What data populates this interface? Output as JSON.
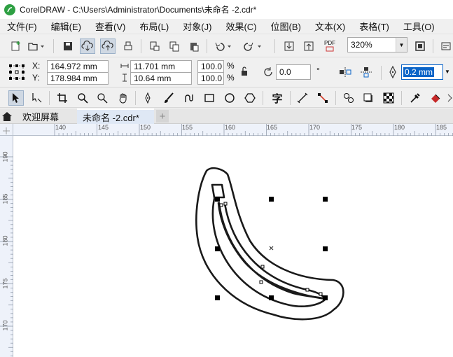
{
  "title_bar": {
    "text": "CorelDRAW - C:\\Users\\Administrator\\Documents\\未命名 -2.cdr*"
  },
  "menu": [
    {
      "label": "文件",
      "key": "(F)"
    },
    {
      "label": "编辑",
      "key": "(E)"
    },
    {
      "label": "查看",
      "key": "(V)"
    },
    {
      "label": "布局",
      "key": "(L)"
    },
    {
      "label": "对象",
      "key": "(J)"
    },
    {
      "label": "效果",
      "key": "(C)"
    },
    {
      "label": "位图",
      "key": "(B)"
    },
    {
      "label": "文本",
      "key": "(X)"
    },
    {
      "label": "表格",
      "key": "(T)"
    },
    {
      "label": "工具",
      "key": "(O)"
    }
  ],
  "standard_toolbar": {
    "zoom": "320%",
    "pdf_label": "PDF"
  },
  "property_bar": {
    "x_label": "X:",
    "x_value": "164.972 mm",
    "y_label": "Y:",
    "y_value": "178.984 mm",
    "width_value": "11.701 mm",
    "height_value": "10.64 mm",
    "scale_x": "100.0",
    "scale_y": "100.0",
    "percent": "%",
    "rotation": "0.0",
    "outline_width": "0.2 mm"
  },
  "toolbox": {
    "text_tool_glyph": "字"
  },
  "tabs": [
    {
      "label": "欢迎屏幕"
    },
    {
      "label": "未命名 -2.cdr*"
    }
  ],
  "ruler_h": [
    "140",
    "145",
    "150",
    "155",
    "160",
    "165",
    "170",
    "175",
    "180",
    "185"
  ],
  "ruler_v": [
    "190",
    "185",
    "180",
    "175",
    "170"
  ],
  "colors": {
    "accent_blue": "#0a64c8",
    "app_green": "#2ea043",
    "selection_highlight": "#0a64c8"
  }
}
